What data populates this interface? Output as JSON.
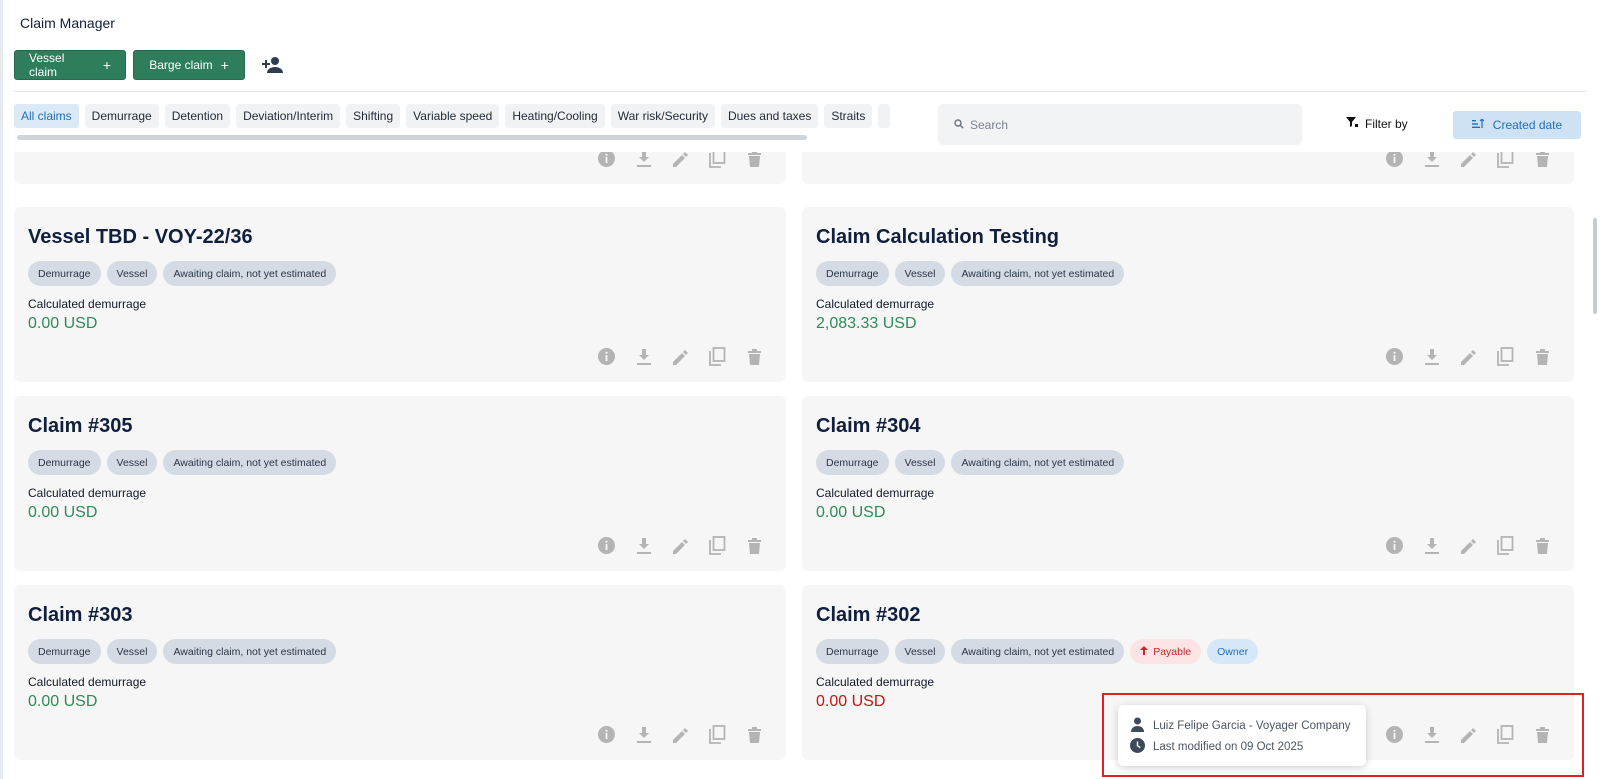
{
  "app": {
    "title": "Claim Manager"
  },
  "toolbar": {
    "vessel_claim_label": "Vessel claim",
    "barge_claim_label": "Barge claim",
    "plus": "+"
  },
  "filters": {
    "chips": [
      "All claims",
      "Demurrage",
      "Detention",
      "Deviation/Interim",
      "Shifting",
      "Variable speed",
      "Heating/Cooling",
      "War risk/Security",
      "Dues and taxes",
      "Straits"
    ],
    "active_chip": "All claims"
  },
  "search": {
    "placeholder": "Search",
    "value": ""
  },
  "filter_by_label": "Filter by",
  "sort_label": "Created date",
  "cards": [
    {
      "title": "Vessel TBD - VOY-22/36",
      "tags": [
        "Demurrage",
        "Vessel",
        "Awaiting claim, not yet estimated"
      ],
      "calc_label": "Calculated demurrage",
      "amount": "0.00 USD"
    },
    {
      "title": "Claim Calculation Testing",
      "tags": [
        "Demurrage",
        "Vessel",
        "Awaiting claim, not yet estimated"
      ],
      "calc_label": "Calculated demurrage",
      "amount": "2,083.33 USD"
    },
    {
      "title": "Claim #305",
      "tags": [
        "Demurrage",
        "Vessel",
        "Awaiting claim, not yet estimated"
      ],
      "calc_label": "Calculated demurrage",
      "amount": "0.00 USD"
    },
    {
      "title": "Claim #304",
      "tags": [
        "Demurrage",
        "Vessel",
        "Awaiting claim, not yet estimated"
      ],
      "calc_label": "Calculated demurrage",
      "amount": "0.00 USD"
    },
    {
      "title": "Claim #303",
      "tags": [
        "Demurrage",
        "Vessel",
        "Awaiting claim, not yet estimated"
      ],
      "calc_label": "Calculated demurrage",
      "amount": "0.00 USD"
    },
    {
      "title": "Claim #302",
      "tags": [
        "Demurrage",
        "Vessel",
        "Awaiting claim, not yet estimated"
      ],
      "payable_label": "Payable",
      "owner_label": "Owner",
      "calc_label": "Calculated demurrage",
      "amount": "0.00 USD"
    }
  ],
  "tooltip": {
    "user": "Luiz Felipe Garcia - Voyager Company",
    "modified": "Last modified on 09 Oct 2025"
  },
  "colors": {
    "primary_green": "#2e7d5b",
    "amount_green": "#2e8b57",
    "amount_red": "#cc1111",
    "active_blue": "#1f6fb8",
    "highlight_red": "#e32020"
  },
  "icons": [
    "add-person-icon",
    "search-icon",
    "filter-icon",
    "sort-icon",
    "info-icon",
    "download-icon",
    "edit-icon",
    "copy-icon",
    "trash-icon",
    "person-icon",
    "clock-icon",
    "arrow-up-icon"
  ]
}
